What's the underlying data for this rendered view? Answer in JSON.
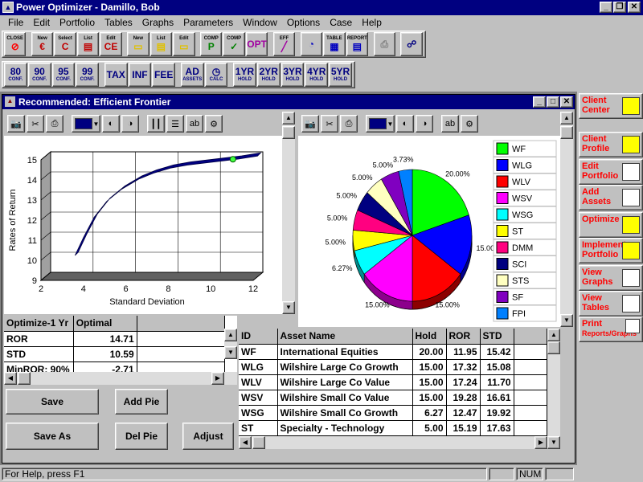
{
  "window": {
    "title": "Power Optimizer - Damillo, Bob",
    "app_icon": "app-icon"
  },
  "menu": [
    "File",
    "Edit",
    "Portfolio",
    "Tables",
    "Graphs",
    "Parameters",
    "Window",
    "Options",
    "Case",
    "Help"
  ],
  "toolbar1": [
    {
      "name": "close",
      "label": "CLOSE",
      "glyph": "⊘",
      "color": "#ff0000"
    },
    {
      "name": "new-client",
      "label": "New",
      "glyph": "€",
      "color": "#c00000"
    },
    {
      "name": "select-client",
      "label": "Select",
      "glyph": "C",
      "color": "#c00000"
    },
    {
      "name": "list-clients",
      "label": "List",
      "glyph": "▤",
      "color": "#c00000"
    },
    {
      "name": "edit-client",
      "label": "Edit",
      "glyph": "CE",
      "color": "#c00000"
    },
    {
      "name": "new-case",
      "label": "New",
      "glyph": "▭",
      "color": "#e0c000"
    },
    {
      "name": "list-cases",
      "label": "List",
      "glyph": "▤",
      "color": "#e0c000"
    },
    {
      "name": "edit-case",
      "label": "Edit",
      "glyph": "▭",
      "color": "#e0c000"
    },
    {
      "name": "comp-p",
      "label": "COMP",
      "glyph": "P",
      "color": "#008000"
    },
    {
      "name": "comp-check",
      "label": "COMP",
      "glyph": "✓",
      "color": "#008000"
    },
    {
      "name": "opt",
      "label": "",
      "glyph": "OPT",
      "color": "#a000a0"
    },
    {
      "name": "eff",
      "label": "EFF",
      "glyph": "╱",
      "color": "#a000a0"
    },
    {
      "name": "graph",
      "label": "",
      "glyph": "◔",
      "color": "#0000c0"
    },
    {
      "name": "table",
      "label": "TABLE",
      "glyph": "▦",
      "color": "#0000c0"
    },
    {
      "name": "report",
      "label": "REPORT",
      "glyph": "▤",
      "color": "#0000c0"
    },
    {
      "name": "print",
      "label": "",
      "glyph": "⎙",
      "color": "#808080"
    },
    {
      "name": "network",
      "label": "",
      "glyph": "☍",
      "color": "#000080"
    }
  ],
  "toolbar2": [
    {
      "name": "conf-80",
      "top": "80",
      "label": "CONF."
    },
    {
      "name": "conf-90",
      "top": "90",
      "label": "CONF."
    },
    {
      "name": "conf-95",
      "top": "95",
      "label": "CONF."
    },
    {
      "name": "conf-99",
      "top": "99",
      "label": "CONF."
    },
    {
      "name": "tax",
      "top": "TAX",
      "label": ""
    },
    {
      "name": "inf",
      "top": "INF",
      "label": ""
    },
    {
      "name": "fee",
      "top": "FEE",
      "label": ""
    },
    {
      "name": "add-assets",
      "top": "AD",
      "label": "ASSETS"
    },
    {
      "name": "calc",
      "top": "◷",
      "label": "CALC"
    },
    {
      "name": "hold-1",
      "top": "1YR",
      "label": "HOLD"
    },
    {
      "name": "hold-2",
      "top": "2YR",
      "label": "HOLD"
    },
    {
      "name": "hold-3",
      "top": "3YR",
      "label": "HOLD"
    },
    {
      "name": "hold-4",
      "top": "4YR",
      "label": "HOLD"
    },
    {
      "name": "hold-5",
      "top": "5YR",
      "label": "HOLD"
    }
  ],
  "child": {
    "title": "Recommended: Efficient Frontier"
  },
  "frontier": {
    "x_label": "Standard Deviation",
    "y_label": "Rates of Return",
    "x_ticks": [
      "2",
      "4",
      "6",
      "8",
      "10",
      "12"
    ],
    "y_ticks": [
      "9",
      "10",
      "11",
      "12",
      "13",
      "14",
      "15"
    ]
  },
  "chart_data": [
    {
      "type": "line",
      "xlabel": "Standard Deviation",
      "ylabel": "Rates of Return",
      "xlim": [
        2,
        12
      ],
      "ylim": [
        9,
        15
      ],
      "x": [
        3.3,
        3.7,
        4.2,
        4.8,
        5.5,
        6.3,
        7.0,
        7.8,
        8.6,
        9.4,
        10.2,
        11.0,
        11.9
      ],
      "y": [
        10.0,
        10.9,
        11.9,
        12.7,
        13.3,
        13.8,
        14.1,
        14.35,
        14.5,
        14.6,
        14.7,
        14.8,
        14.95
      ],
      "optimal_point": {
        "x": 10.59,
        "y": 14.71
      }
    },
    {
      "type": "pie",
      "labels": [
        "WF",
        "WLG",
        "WLV",
        "WSV",
        "WSG",
        "ST",
        "DMM",
        "SCI",
        "STS",
        "SF",
        "FPI"
      ],
      "values": [
        20.0,
        15.0,
        15.0,
        15.0,
        6.27,
        5.0,
        5.0,
        5.0,
        5.0,
        5.0,
        3.73
      ],
      "value_labels": [
        "20.00%",
        "15.00%",
        "15.00%",
        "15.00%",
        "6.27%",
        "5.00%",
        "5.00%",
        "5.00%",
        "5.00%",
        "5.00%",
        "3.73%"
      ],
      "colors": [
        "#00ff00",
        "#0000ff",
        "#ff0000",
        "#ff00ff",
        "#00ffff",
        "#ffff00",
        "#ff0080",
        "#000080",
        "#ffffc0",
        "#8000c0",
        "#0080ff"
      ]
    }
  ],
  "legend": [
    "WF",
    "WLG",
    "WLV",
    "WSV",
    "WSG",
    "ST",
    "DMM",
    "SCI",
    "STS",
    "SF",
    "FPI"
  ],
  "optimize_table": {
    "headers": [
      "Optimize-1 Yr",
      "Optimal"
    ],
    "rows": [
      [
        "ROR",
        "14.71"
      ],
      [
        "STD",
        "10.59"
      ],
      [
        "MinROR: 90%",
        "-2.71"
      ]
    ]
  },
  "buttons": {
    "save": "Save",
    "add_pie": "Add Pie",
    "save_as": "Save As",
    "del_pie": "Del Pie",
    "adjust": "Adjust"
  },
  "asset_table": {
    "headers": [
      "ID",
      "Asset Name",
      "Hold",
      "ROR",
      "STD"
    ],
    "rows": [
      [
        "WF",
        "International Equities",
        "20.00",
        "11.95",
        "15.42"
      ],
      [
        "WLG",
        "Wilshire Large Co Growth",
        "15.00",
        "17.32",
        "15.08"
      ],
      [
        "WLV",
        "Wilshire Large Co Value",
        "15.00",
        "17.24",
        "11.70"
      ],
      [
        "WSV",
        "Wilshire Small Co Value",
        "15.00",
        "19.28",
        "16.61"
      ],
      [
        "WSG",
        "Wilshire Small Co Growth",
        "6.27",
        "12.47",
        "19.92"
      ],
      [
        "ST",
        "Specialty - Technology",
        "5.00",
        "15.19",
        "17.63"
      ]
    ]
  },
  "sidebar": [
    {
      "name": "client-center",
      "line1": "Client",
      "line2": "Center"
    },
    {
      "name": "client-profile",
      "line1": "Client",
      "line2": "Profile"
    },
    {
      "name": "edit-portfolio",
      "line1": "Edit",
      "line2": "Portfolio"
    },
    {
      "name": "add-assets",
      "line1": "Add",
      "line2": "Assets"
    },
    {
      "name": "optimize",
      "line1": "Optimize",
      "line2": ""
    },
    {
      "name": "implement-portfolio",
      "line1": "Implement",
      "line2": "Portfolio"
    },
    {
      "name": "view-graphs",
      "line1": "View",
      "line2": "Graphs"
    },
    {
      "name": "view-tables",
      "line1": "View",
      "line2": "Tables"
    },
    {
      "name": "print-reports",
      "line1": "Print",
      "line2": "Reports/Graphs"
    }
  ],
  "status": {
    "help": "For Help, press F1",
    "num": "NUM"
  }
}
